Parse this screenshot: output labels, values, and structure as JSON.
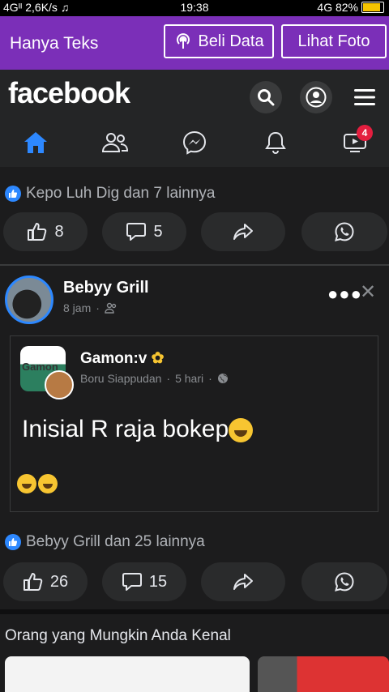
{
  "status": {
    "left": "4Gᴵᴵ 2,6K/s",
    "music_icon": "music-note-icon",
    "time": "19:38",
    "right": "4G 82%"
  },
  "databar": {
    "title": "Hanya Teks",
    "buy_data": "Beli Data",
    "view_photo": "Lihat Foto"
  },
  "facebook": {
    "logo": "facebook",
    "notification_count": "4"
  },
  "post1": {
    "likes_text": "Kepo Luh Dig dan 7 lainnya",
    "like_count": "8",
    "comment_count": "5"
  },
  "post2": {
    "author": "Bebyy Grill",
    "time": "8 jam",
    "shared": {
      "author": "Gamon:v",
      "group": "Boru Siappudan",
      "time": "5 hari",
      "thumb_text": "Gamon",
      "text": "Inisial R raja bokep"
    },
    "likes_text": "Bebyy Grill dan 25 lainnya",
    "like_count": "26",
    "comment_count": "15"
  },
  "suggestions": {
    "title": "Orang yang Mungkin Anda Kenal"
  },
  "colors": {
    "databar": "#7b2fb8",
    "fb_blue": "#2d88ff",
    "background": "#1c1c1d"
  }
}
